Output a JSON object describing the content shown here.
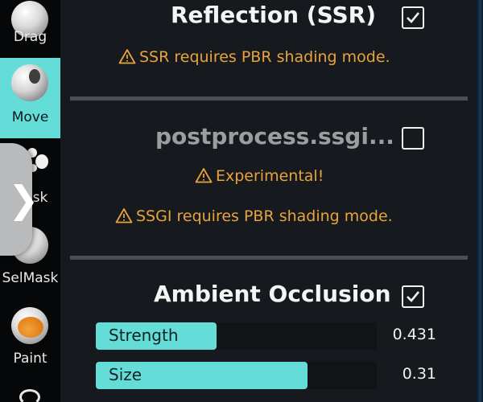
{
  "toolbar": {
    "tools": [
      {
        "label": "Drag"
      },
      {
        "label": "Move",
        "active": true
      },
      {
        "label": "Mask"
      },
      {
        "label": "SelMask"
      },
      {
        "label": "Paint"
      }
    ],
    "handle_icon": "chevron-right-icon"
  },
  "sections": {
    "ssr": {
      "title": "Reflection (SSR)",
      "checked": true,
      "warning": "SSR requires PBR shading mode."
    },
    "ssgi": {
      "title": "postprocess.ssgi...",
      "checked": false,
      "warnings": [
        "Experimental!",
        "SSGI requires PBR shading mode."
      ]
    },
    "ao": {
      "title": "Ambient Occlusion",
      "checked": true,
      "sliders": [
        {
          "label": "Strength",
          "value": "0.431",
          "fraction": 0.431
        },
        {
          "label": "Size",
          "value": "0.31",
          "fraction": 0.753
        }
      ]
    }
  },
  "colors": {
    "accent": "#64ddd9",
    "warning": "#e9a33c",
    "panel_bg": "#16191d"
  }
}
